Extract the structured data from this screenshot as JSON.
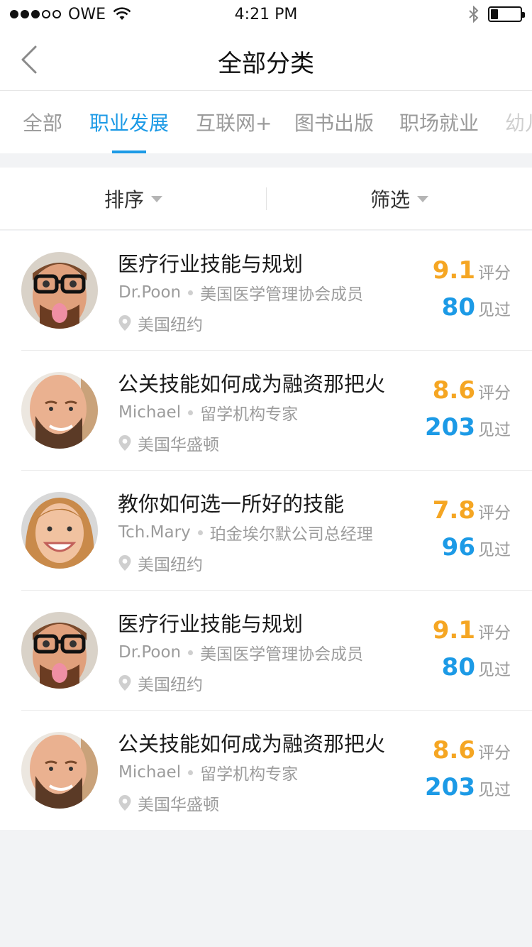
{
  "status": {
    "carrier": "OWE",
    "time": "4:21 PM",
    "battery_fraction": 0.25
  },
  "nav": {
    "title": "全部分类",
    "back_icon": "chevron-left-icon"
  },
  "tabs": [
    {
      "label": "全部"
    },
    {
      "label": "职业发展"
    },
    {
      "label": "互联网+"
    },
    {
      "label": "图书出版"
    },
    {
      "label": "职场就业"
    },
    {
      "label": "幼儿"
    }
  ],
  "active_tab": "职业发展",
  "filters": {
    "sort_label": "排序",
    "filter_label": "筛选"
  },
  "items": [
    {
      "title": "医疗行业技能与规划",
      "name": "Dr.Poon",
      "role": "美国医学管理协会成员",
      "location": "美国纽约",
      "score": "9.1",
      "score_unit": "评分",
      "seen": "80",
      "seen_unit": "见过",
      "avatar": "man-glasses-tongue"
    },
    {
      "title": "公关技能如何成为融资那把火",
      "name": "Michael",
      "role": "留学机构专家",
      "location": "美国华盛顿",
      "score": "8.6",
      "score_unit": "评分",
      "seen": "203",
      "seen_unit": "见过",
      "avatar": "bald-man-beard"
    },
    {
      "title": "教你如何选一所好的技能",
      "name": "Tch.Mary",
      "role": "珀金埃尔默公司总经理",
      "location": "美国纽约",
      "score": "7.8",
      "score_unit": "评分",
      "seen": "96",
      "seen_unit": "见过",
      "avatar": "smiling-woman"
    },
    {
      "title": "医疗行业技能与规划",
      "name": "Dr.Poon",
      "role": "美国医学管理协会成员",
      "location": "美国纽约",
      "score": "9.1",
      "score_unit": "评分",
      "seen": "80",
      "seen_unit": "见过",
      "avatar": "man-glasses-tongue"
    },
    {
      "title": "公关技能如何成为融资那把火",
      "name": "Michael",
      "role": "留学机构专家",
      "location": "美国华盛顿",
      "score": "8.6",
      "score_unit": "评分",
      "seen": "203",
      "seen_unit": "见过",
      "avatar": "bald-man-beard"
    }
  ],
  "colors": {
    "accent": "#1c9ae6",
    "score": "#f5a623",
    "muted": "#9c9c9c"
  }
}
